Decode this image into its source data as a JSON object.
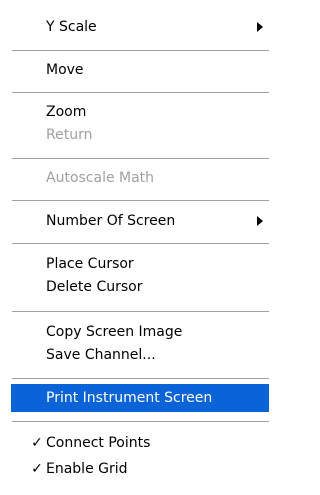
{
  "menu": {
    "y_scale": "Y Scale",
    "move": "Move",
    "zoom": "Zoom",
    "return": "Return",
    "autoscale_math": "Autoscale Math",
    "number_of_screen": "Number Of Screen",
    "place_cursor": "Place Cursor",
    "delete_cursor": "Delete Cursor",
    "copy_screen_image": "Copy Screen Image",
    "save_channel": "Save Channel...",
    "print_instrument_screen": "Print Instrument Screen",
    "connect_points": "Connect Points",
    "enable_grid": "Enable Grid",
    "check_glyph": "✓"
  },
  "colors": {
    "highlight": "#0a64d8",
    "disabled_text": "#a0a0a0",
    "separator": "#a0a0a0"
  },
  "icons": {
    "submenu": "submenu-arrow-icon",
    "check": "checkmark-icon"
  }
}
